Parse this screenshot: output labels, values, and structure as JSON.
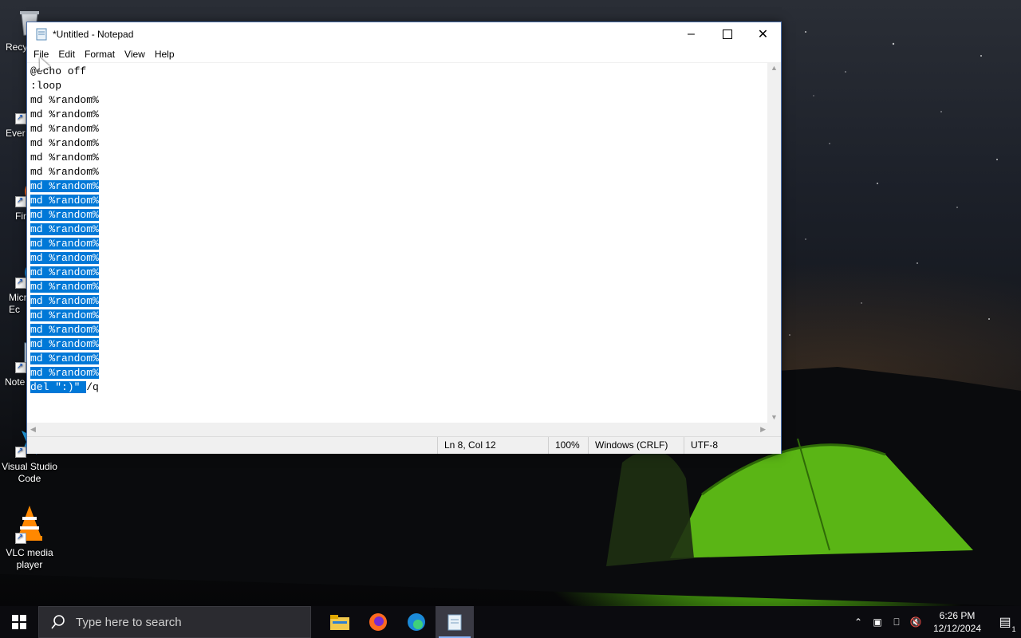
{
  "desktop": {
    "icons": [
      {
        "label": "Recy",
        "icon": "recycle-bin-icon"
      },
      {
        "label": "Ever",
        "icon": "everything-icon"
      },
      {
        "label": "Fir",
        "icon": "firefox-icon"
      },
      {
        "label": "Micr Ec",
        "icon": "edge-icon"
      },
      {
        "label": "Note",
        "icon": "notepad-icon"
      },
      {
        "label": "Visual Studio Code",
        "icon": "vscode-icon"
      },
      {
        "label": "VLC media player",
        "icon": "vlc-icon"
      }
    ]
  },
  "notepad": {
    "title": "*Untitled - Notepad",
    "menu": [
      "File",
      "Edit",
      "Format",
      "View",
      "Help"
    ],
    "lines_unselected": "@echo off\n:loop\nmd %random%\nmd %random%\nmd %random%\nmd %random%\nmd %random%\nmd %random%",
    "lines_selected": "md %random%\nmd %random%\nmd %random%\nmd %random%\nmd %random%\nmd %random%\nmd %random%\nmd %random%\nmd %random%\nmd %random%\nmd %random%\nmd %random%\nmd %random%\nmd %random%\ndel \":)\" ",
    "line_tail": "/q",
    "status": {
      "position": "Ln 8, Col 12",
      "zoom": "100%",
      "line_ending": "Windows (CRLF)",
      "encoding": "UTF-8"
    }
  },
  "taskbar": {
    "search_placeholder": "Type here to search",
    "apps": [
      "file-explorer-icon",
      "firefox-icon",
      "edge-icon",
      "notepad-icon"
    ],
    "active_app": "notepad-icon",
    "time": "6:26 PM",
    "date": "12/12/2024",
    "notification_count": "1"
  },
  "colors": {
    "selection": "#0078d7",
    "taskbar": "#0b0b0f",
    "accent": "#4a6ea9"
  }
}
